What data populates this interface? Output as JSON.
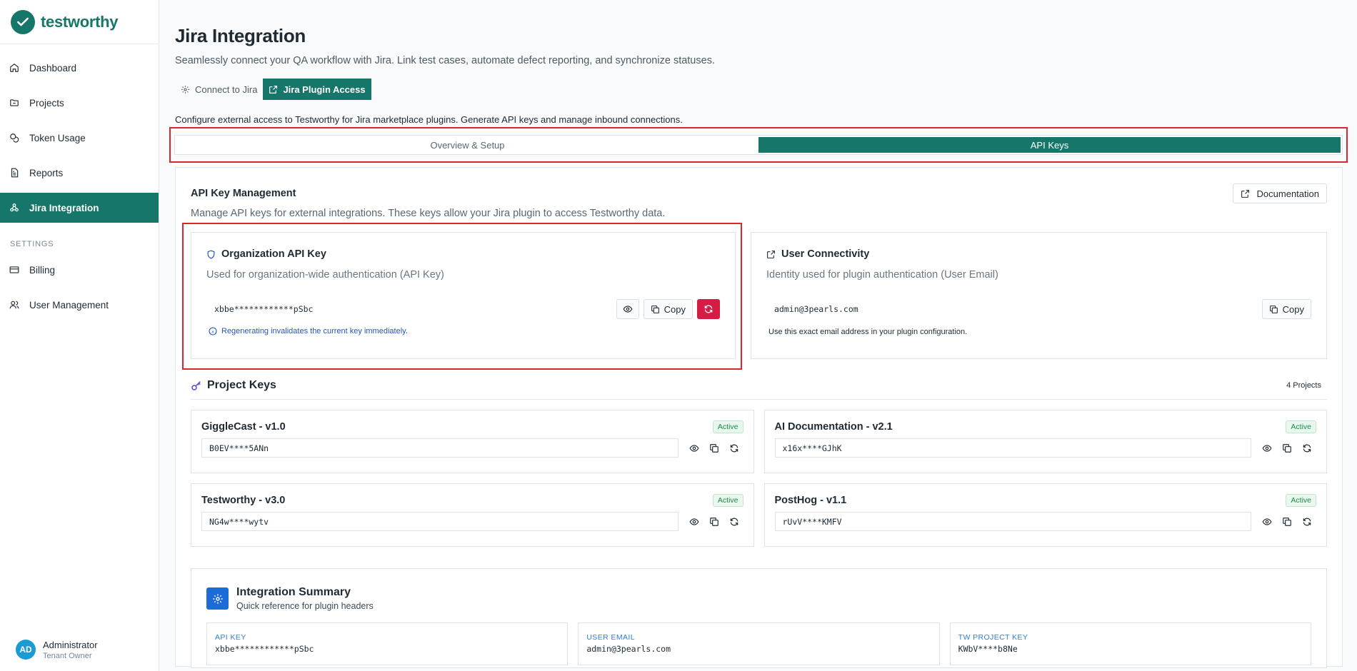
{
  "brand": {
    "name": "testworthy",
    "color": "#17766a"
  },
  "sidebar": {
    "items": [
      {
        "label": "Dashboard",
        "icon": "home-icon"
      },
      {
        "label": "Projects",
        "icon": "folder-icon"
      },
      {
        "label": "Token Usage",
        "icon": "coins-icon"
      },
      {
        "label": "Reports",
        "icon": "file-text-icon"
      },
      {
        "label": "Jira Integration",
        "icon": "webhook-icon",
        "active": true
      }
    ],
    "settings_heading": "SETTINGS",
    "settings_items": [
      {
        "label": "Billing",
        "icon": "credit-card-icon"
      },
      {
        "label": "User Management",
        "icon": "users-icon"
      }
    ],
    "user": {
      "initials": "AD",
      "name": "Administrator",
      "role": "Tenant Owner"
    }
  },
  "header": {
    "title": "Jira Integration",
    "subtitle": "Seamlessly connect your QA workflow with Jira. Link test cases, automate defect reporting, and synchronize statuses."
  },
  "top_tabs": [
    {
      "label": "Connect to Jira",
      "icon": "gear-icon"
    },
    {
      "label": "Jira Plugin Access",
      "icon": "external-link-icon",
      "active": true
    }
  ],
  "config_text": "Configure external access to Testworthy for Jira marketplace plugins. Generate API keys and manage inbound connections.",
  "sub_tabs": [
    {
      "label": "Overview & Setup"
    },
    {
      "label": "API Keys",
      "active": true
    }
  ],
  "api_mgmt": {
    "title": "API Key Management",
    "doc_label": "Documentation",
    "subtitle": "Manage API keys for external integrations. These keys allow your Jira plugin to access Testworthy data."
  },
  "org_card": {
    "title": "Organization API Key",
    "subtitle": "Used for organization-wide authentication (API Key)",
    "key": "xbbe************pSbc",
    "copy_label": "Copy",
    "note": "Regenerating invalidates the current key immediately."
  },
  "user_card": {
    "title": "User Connectivity",
    "subtitle": "Identity used for plugin authentication (User Email)",
    "email": "admin@3pearls.com",
    "copy_label": "Copy",
    "note": "Use this exact email address in your plugin configuration."
  },
  "project_keys": {
    "title": "Project Keys",
    "count": "4 Projects",
    "projects": [
      {
        "name": "GiggleCast - v1.0",
        "status": "Active",
        "key": "B0EV****5ANn"
      },
      {
        "name": "AI Documentation - v2.1",
        "status": "Active",
        "key": "x16x****GJhK"
      },
      {
        "name": "Testworthy - v3.0",
        "status": "Active",
        "key": "NG4w****wytv"
      },
      {
        "name": "PostHog - v1.1",
        "status": "Active",
        "key": "rUvV****KMFV"
      }
    ]
  },
  "summary": {
    "title": "Integration Summary",
    "subtitle": "Quick reference for plugin headers",
    "cells": [
      {
        "label": "API KEY",
        "value": "xbbe************pSbc"
      },
      {
        "label": "USER EMAIL",
        "value": "admin@3pearls.com"
      },
      {
        "label": "TW PROJECT KEY",
        "value": "KWbV****b8Ne"
      }
    ]
  },
  "colors": {
    "accent": "#17766a",
    "danger": "#d81b45",
    "highlight": "#d9272d",
    "info": "#2557b8"
  }
}
